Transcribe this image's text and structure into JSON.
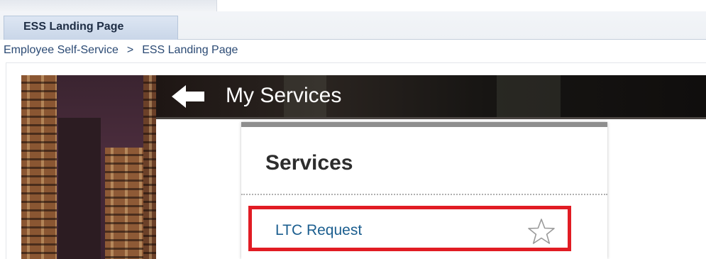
{
  "tabs": [
    {
      "label": "ESS Landing Page",
      "active": true
    }
  ],
  "breadcrumb": {
    "items": [
      "Employee Self-Service",
      "ESS Landing Page"
    ],
    "separator": ">"
  },
  "header": {
    "title": "My Services",
    "back_icon": "left-arrow-icon"
  },
  "services": {
    "title": "Services",
    "items": [
      {
        "label": "LTC Request",
        "favorite_icon": "star-outline-icon",
        "highlighted": true
      }
    ]
  },
  "colors": {
    "highlight_border": "#e11c24",
    "link": "#1b5e8f",
    "tab_background": "#c9d6e8",
    "header_background": "#1e1614"
  }
}
